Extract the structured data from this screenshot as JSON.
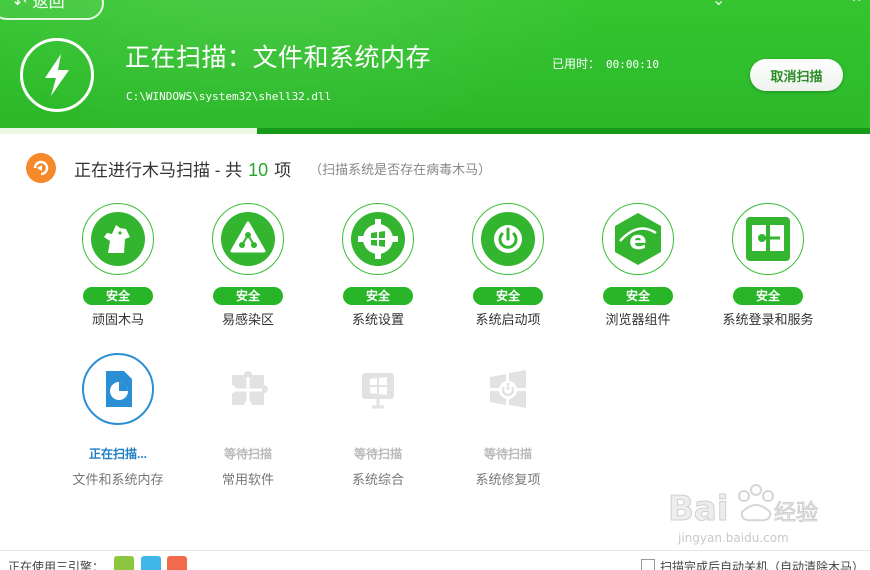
{
  "header": {
    "back_label": "返回",
    "title": "正在扫描：文件和系统内存",
    "current_path": "C:\\WINDOWS\\system32\\shell32.dll",
    "elapsed_label": "已用时：",
    "elapsed_time": "00:00:10",
    "cancel_label": "取消扫描",
    "progress": 0.295,
    "accent_color": "#2bb82a"
  },
  "section": {
    "title_prefix": "正在进行木马扫描 - 共",
    "count": "10",
    "title_suffix": "项",
    "subtitle": "（扫描系统是否存在病毒木马）"
  },
  "items_row1": [
    {
      "label": "顽固木马",
      "status": "安全",
      "icon": "horse-icon"
    },
    {
      "label": "易感染区",
      "status": "安全",
      "icon": "biohazard-icon"
    },
    {
      "label": "系统设置",
      "status": "安全",
      "icon": "windows-gear-icon"
    },
    {
      "label": "系统启动项",
      "status": "安全",
      "icon": "power-icon"
    },
    {
      "label": "浏览器组件",
      "status": "安全",
      "icon": "ie-icon"
    },
    {
      "label": "系统登录和服务",
      "status": "安全",
      "icon": "login-service-icon"
    }
  ],
  "items_row2": [
    {
      "label": "文件和系统内存",
      "status": "正在扫描...",
      "icon": "pie-file-icon"
    },
    {
      "label": "常用软件",
      "status": "等待扫描",
      "icon": "puzzle-icon"
    },
    {
      "label": "系统综合",
      "status": "等待扫描",
      "icon": "windows-shield-icon"
    },
    {
      "label": "系统修复项",
      "status": "等待扫描",
      "icon": "windows-repair-icon"
    }
  ],
  "footer": {
    "engine_label": "正在使用三引擎：",
    "option_label": "扫描完成后自动关机（自动清除木马）"
  }
}
